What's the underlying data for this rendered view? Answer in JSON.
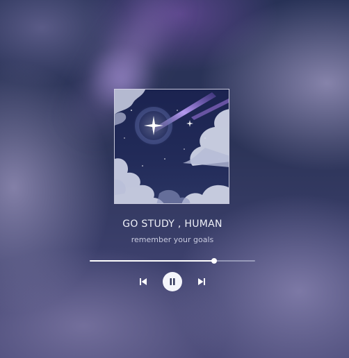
{
  "player": {
    "title": "GO STUDY , HUMAN",
    "subtitle": "remember your goals",
    "progress_fraction": 0.75,
    "art_icon": "night-sky-shooting-star-artwork"
  },
  "controls": {
    "previous_icon": "skip-previous-icon",
    "play_pause_icon": "pause-icon",
    "next_icon": "skip-next-icon"
  },
  "colors": {
    "text_primary": "#eef0f8",
    "text_secondary": "#c9cbe0",
    "progress_fill": "#ffffff",
    "progress_track": "#c8cde1",
    "play_button": "#f4f5fb"
  }
}
